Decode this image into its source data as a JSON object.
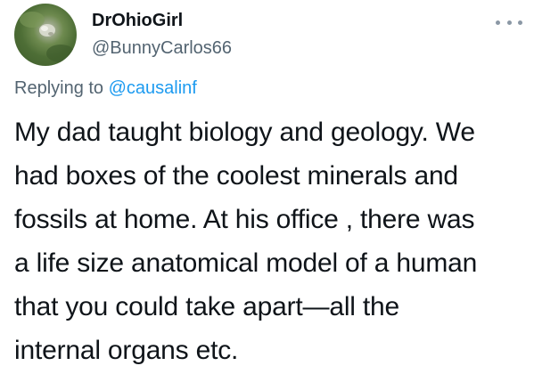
{
  "author": {
    "display_name": "DrOhioGirl",
    "handle": "@BunnyCarlos66"
  },
  "reply": {
    "prefix": "Replying to ",
    "mention": "@causalinf"
  },
  "tweet": {
    "lines": [
      "My dad taught biology and geology. We",
      "had boxes of the coolest minerals and",
      "fossils at home. At his office , there was",
      "a life size anatomical model of a human",
      "that you could take apart—all the",
      "internal organs etc."
    ]
  },
  "icons": {
    "more": "more-horizontal-icon"
  },
  "colors": {
    "text": "#0f1419",
    "secondary": "#536471",
    "link": "#1d9bf0"
  }
}
